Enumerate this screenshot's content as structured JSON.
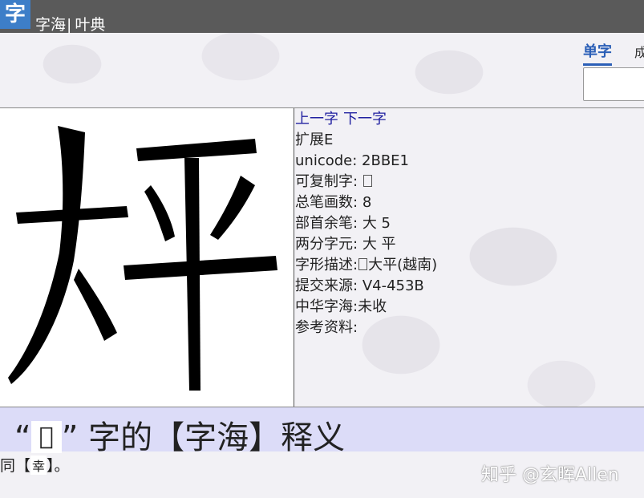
{
  "header": {
    "logo_char": "字",
    "site_name": "字海",
    "separator": "|",
    "subtitle": "叶典"
  },
  "tabs": {
    "active": "单字",
    "next": "成"
  },
  "search": {
    "value": "",
    "placeholder": ""
  },
  "info": {
    "prev_label": "上一字",
    "next_label": "下一字",
    "block": "扩展E",
    "rows": [
      {
        "label": "unicode:",
        "value": "2BBE1"
      },
      {
        "label": "可复制字:",
        "value": ""
      },
      {
        "label": "总笔画数:",
        "value": "8"
      },
      {
        "label": "部首余笔:",
        "value": "大 5"
      },
      {
        "label": "两分字元:",
        "value": "大 平"
      },
      {
        "label": "字形描述:",
        "value": "大平(越南)"
      },
      {
        "label": "提交来源:",
        "value": "V4-453B"
      },
      {
        "label": "中华字海:",
        "value": "未收"
      },
      {
        "label": "参考资料:",
        "value": ""
      }
    ]
  },
  "definition": {
    "heading_open": "“",
    "heading_char": "𫯡",
    "heading_close": "”",
    "heading_rest": " 字的【字海】释义",
    "line_prefix": "同【",
    "line_char": "幸",
    "line_suffix": "】。"
  },
  "watermark": "知乎 @玄晖Allen"
}
